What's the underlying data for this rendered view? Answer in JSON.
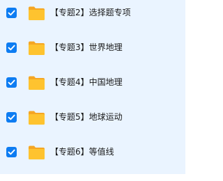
{
  "items": [
    {
      "label": "【专题2】选择题专项",
      "checked": true
    },
    {
      "label": "【专题3】世界地理",
      "checked": true
    },
    {
      "label": "【专题4】中国地理",
      "checked": true
    },
    {
      "label": "【专题5】地球运动",
      "checked": true
    },
    {
      "label": "【专题6】等值线",
      "checked": true
    }
  ],
  "icons": {
    "checkbox": "checkbox-checked-icon",
    "folder": "folder-icon"
  },
  "colors": {
    "row_background": "#eaf4ff",
    "checkbox": "#0d7cf2",
    "folder_front": "#fec32f",
    "folder_back": "#f5a623",
    "text": "#1a1a1a"
  }
}
